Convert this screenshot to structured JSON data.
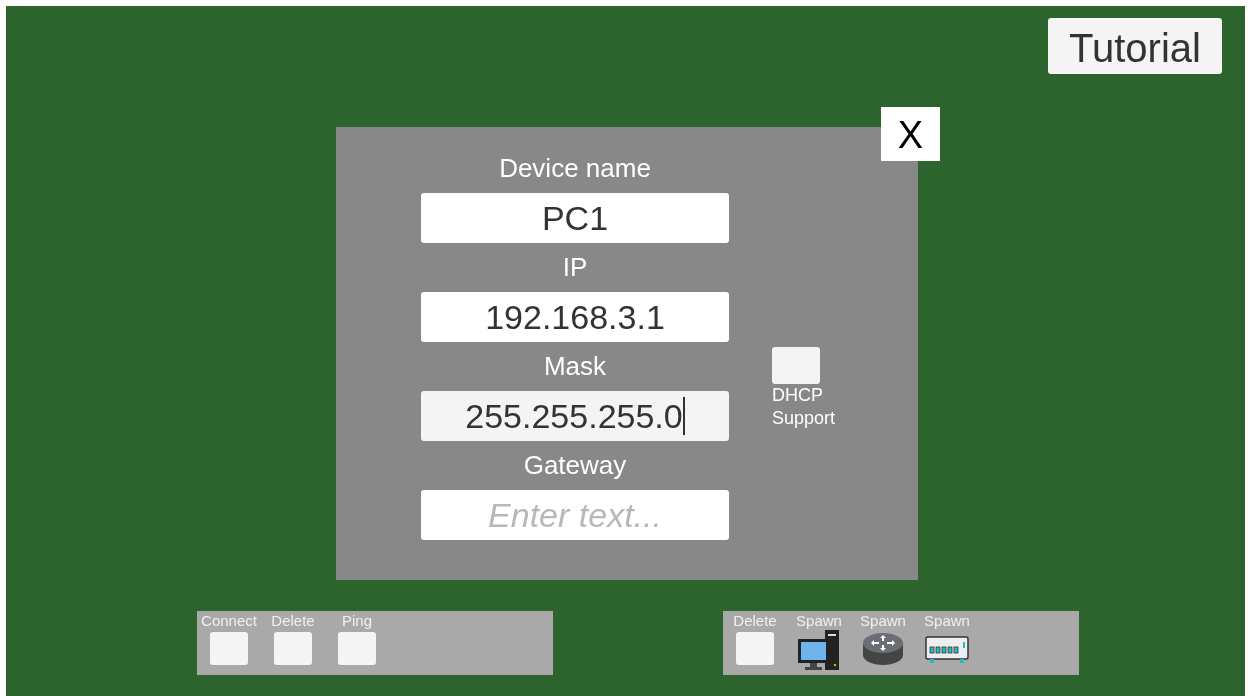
{
  "tutorial_button": "Tutorial",
  "dialog": {
    "close": "X",
    "fields": [
      {
        "label": "Device name",
        "value": "PC1",
        "focused": false
      },
      {
        "label": "IP",
        "value": "192.168.3.1",
        "focused": false
      },
      {
        "label": "Mask",
        "value": "255.255.255.0",
        "focused": true
      },
      {
        "label": "Gateway",
        "placeholder": "Enter text...",
        "focused": false
      }
    ],
    "dhcp": {
      "label": "DHCP Support",
      "checked": false
    }
  },
  "left_toolbar": [
    {
      "label": "Connect",
      "kind": "button"
    },
    {
      "label": "Delete",
      "kind": "button"
    },
    {
      "label": "Ping",
      "kind": "button"
    }
  ],
  "right_toolbar": [
    {
      "label": "Delete",
      "kind": "button"
    },
    {
      "label": "Spawn",
      "kind": "pc"
    },
    {
      "label": "Spawn",
      "kind": "router"
    },
    {
      "label": "Spawn",
      "kind": "switch"
    }
  ]
}
